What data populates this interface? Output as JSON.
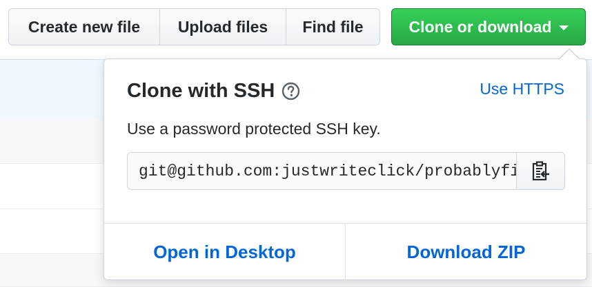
{
  "toolbar": {
    "create_new_file": "Create new file",
    "upload_files": "Upload files",
    "find_file": "Find file",
    "clone_or_download": "Clone or download"
  },
  "clone_panel": {
    "title": "Clone with SSH",
    "switch_link": "Use HTTPS",
    "description": "Use a password protected SSH key.",
    "url": "git@github.com:justwriteclick/probablyfine.git",
    "open_desktop": "Open in Desktop",
    "download_zip": "Download ZIP"
  },
  "icons": {
    "help": "question-circle-icon",
    "copy": "clipboard-icon",
    "caret": "caret-down-icon"
  },
  "colors": {
    "primary_green": "#28a745",
    "link_blue": "#0366d6"
  }
}
